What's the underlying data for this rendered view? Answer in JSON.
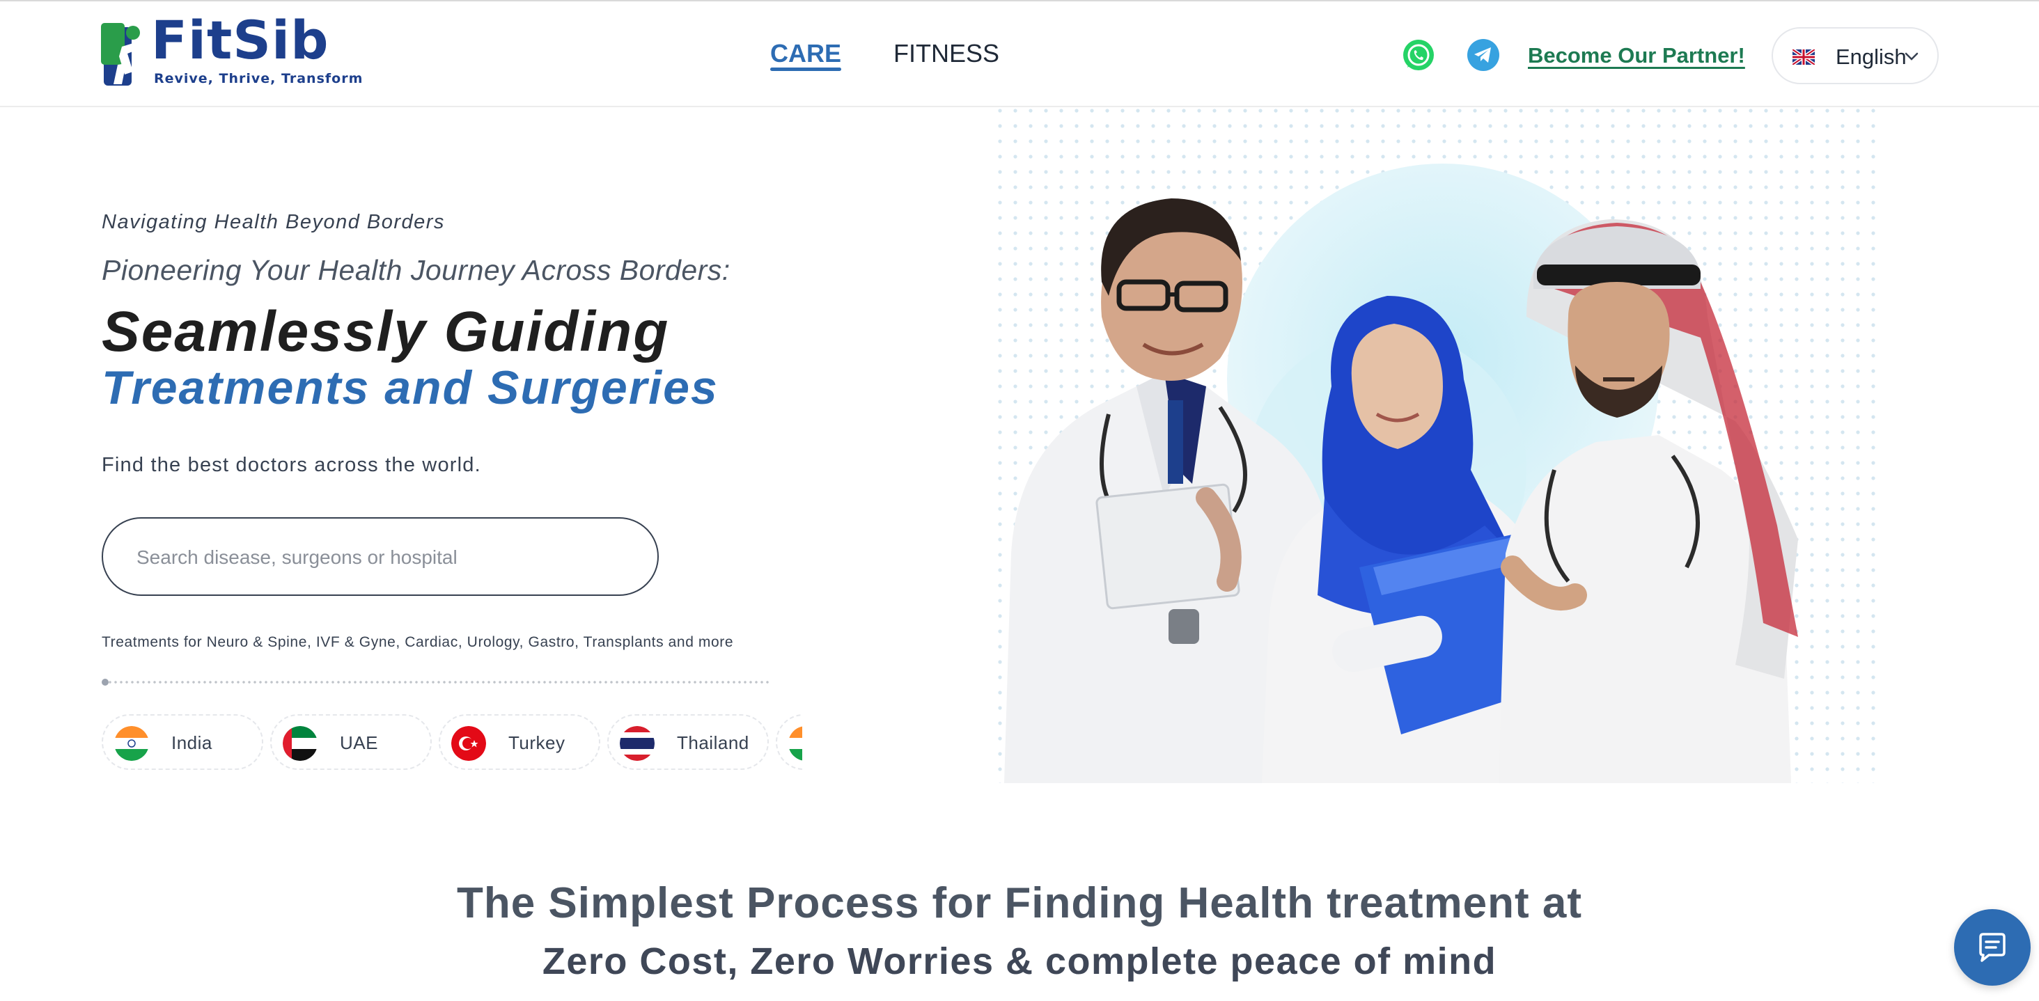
{
  "brand": {
    "name": "FitSib",
    "tagline": "Revive, Thrive, Transform",
    "colors": {
      "primary": "#1d3f8c",
      "accent": "#2d6cb3",
      "partner": "#1d7a52",
      "logo_green": "#2a9d4a"
    }
  },
  "nav": {
    "items": [
      {
        "label": "CARE",
        "active": true
      },
      {
        "label": "FITNESS",
        "active": false
      }
    ]
  },
  "header": {
    "whatsapp_icon": "whatsapp-icon",
    "telegram_icon": "telegram-icon",
    "partner_link": "Become Our Partner!",
    "language": {
      "selected": "English",
      "flag": "uk-flag-icon"
    }
  },
  "hero": {
    "kicker": "Navigating Health Beyond Borders",
    "subhead": "Pioneering Your Health Journey Across Borders:",
    "headline_line1": "Seamlessly Guiding",
    "headline_line2": "Treatments and Surgeries",
    "tagline": "Find the best doctors across the world.",
    "search": {
      "placeholder": "Search disease, surgeons or hospital",
      "value": ""
    },
    "treatments_note": "Treatments for Neuro & Spine, IVF & Gyne, Cardiac, Urology, Gastro, Transplants and more",
    "countries": [
      {
        "name": "India",
        "flag": "india-flag-icon"
      },
      {
        "name": "UAE",
        "flag": "uae-flag-icon"
      },
      {
        "name": "Turkey",
        "flag": "turkey-flag-icon"
      },
      {
        "name": "Thailand",
        "flag": "thailand-flag-icon"
      }
    ]
  },
  "process": {
    "line1": "The Simplest Process for Finding Health treatment at",
    "line2": "Zero Cost, Zero Worries & complete peace of mind"
  },
  "chat": {
    "icon": "chat-icon"
  }
}
